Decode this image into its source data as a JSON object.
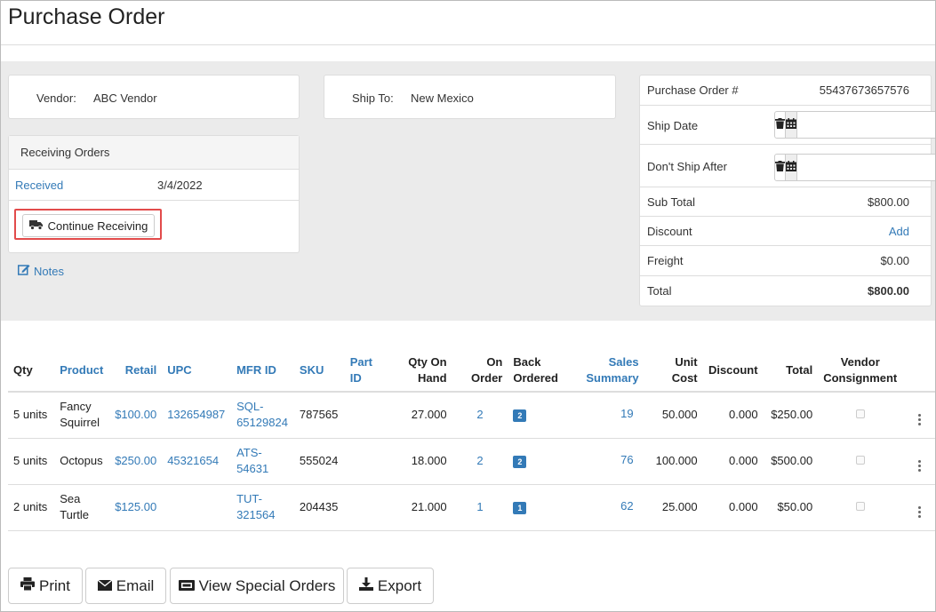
{
  "page": {
    "title": "Purchase Order"
  },
  "vendor": {
    "label": "Vendor:",
    "value": "ABC Vendor"
  },
  "ship_to": {
    "label": "Ship To:",
    "value": "New Mexico"
  },
  "receiving": {
    "heading": "Receiving Orders",
    "received_link": "Received",
    "received_date": "3/4/2022",
    "continue_button": "Continue Receiving",
    "truck_icon": "truck-icon"
  },
  "notes": {
    "label": "Notes",
    "icon": "edit-icon"
  },
  "po": {
    "number_label": "Purchase Order #",
    "number_value": "55437673657576",
    "ship_date_label": "Ship Date",
    "ship_date_value": "",
    "dont_ship_after_label": "Don't Ship After",
    "dont_ship_after_value": "",
    "subtotal_label": "Sub Total",
    "subtotal_value": "$800.00",
    "discount_label": "Discount",
    "discount_action": "Add",
    "freight_label": "Freight",
    "freight_value": "$0.00",
    "total_label": "Total",
    "total_value": "$800.00"
  },
  "table": {
    "headers": {
      "qty": "Qty",
      "product": "Product",
      "retail": "Retail",
      "upc": "UPC",
      "mfr_id": "MFR ID",
      "sku": "SKU",
      "part_id": "Part ID",
      "qty_on_hand": "Qty On Hand",
      "on_order": "On Order",
      "back_ordered": "Back Ordered",
      "sales_summary": "Sales Summary",
      "unit_cost": "Unit Cost",
      "discount": "Discount",
      "total": "Total",
      "vendor_consignment": "Vendor Consignment"
    },
    "rows": [
      {
        "qty": "5 units",
        "product": "Fancy Squirrel",
        "retail": "$100.00",
        "upc": "132654987",
        "mfr_id": "SQL-65129824",
        "sku": "787565",
        "part_id": "",
        "qty_on_hand": "27.000",
        "on_order": "2",
        "back_ordered": "2",
        "sales_summary": "19",
        "unit_cost": "50.000",
        "discount": "0.000",
        "total": "$250.00"
      },
      {
        "qty": "5 units",
        "product": "Octopus",
        "retail": "$250.00",
        "upc": "45321654",
        "mfr_id": "ATS-54631",
        "sku": "555024",
        "part_id": "",
        "qty_on_hand": "18.000",
        "on_order": "2",
        "back_ordered": "2",
        "sales_summary": "76",
        "unit_cost": "100.000",
        "discount": "0.000",
        "total": "$500.00"
      },
      {
        "qty": "2 units",
        "product": "Sea Turtle",
        "retail": "$125.00",
        "upc": "",
        "mfr_id": "TUT-321564",
        "sku": "204435",
        "part_id": "",
        "qty_on_hand": "21.000",
        "on_order": "1",
        "back_ordered": "1",
        "sales_summary": "62",
        "unit_cost": "25.000",
        "discount": "0.000",
        "total": "$50.00"
      }
    ]
  },
  "footer": {
    "print": "Print",
    "email": "Email",
    "view_special_orders": "View Special Orders",
    "export": "Export"
  },
  "colors": {
    "link": "#337ab7",
    "highlight": "#e24b4b",
    "background_gray": "#ebebeb"
  }
}
